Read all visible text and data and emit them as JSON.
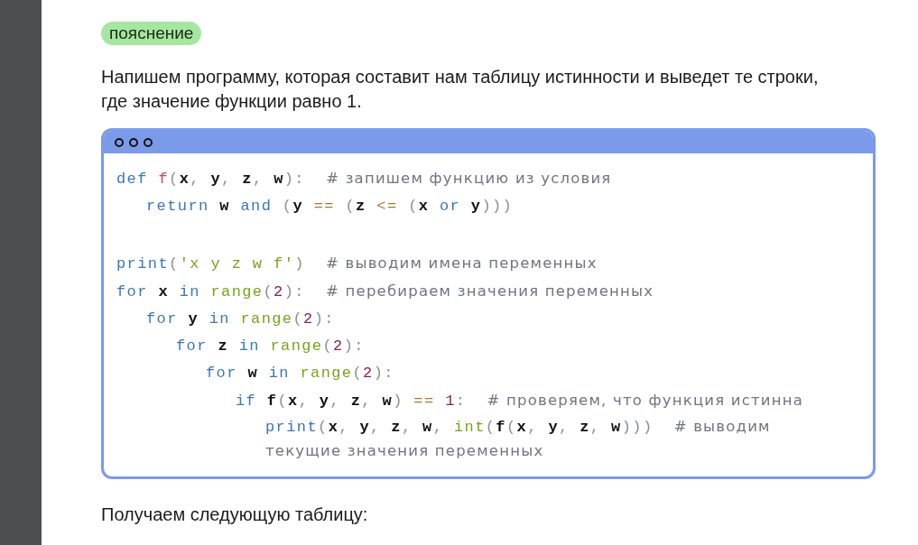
{
  "badge": "пояснение",
  "intro": "Напишем программу, которая составит нам таблицу истинности и выведет те строки, где значение функции равно 1.",
  "code_window": {
    "lines": [
      {
        "tokens": [
          {
            "kind": "kw",
            "text": "def "
          },
          {
            "kind": "def",
            "text": "f"
          },
          {
            "kind": "punct",
            "text": "("
          },
          {
            "kind": "name",
            "text": "x"
          },
          {
            "kind": "punct",
            "text": ", "
          },
          {
            "kind": "name",
            "text": "y"
          },
          {
            "kind": "punct",
            "text": ", "
          },
          {
            "kind": "name",
            "text": "z"
          },
          {
            "kind": "punct",
            "text": ", "
          },
          {
            "kind": "name",
            "text": "w"
          },
          {
            "kind": "punct",
            "text": "):  "
          },
          {
            "kind": "comment",
            "text": "# запишем функцию из условия"
          }
        ],
        "children": [
          {
            "tokens": [
              {
                "kind": "kw",
                "text": "return "
              },
              {
                "kind": "name",
                "text": "w "
              },
              {
                "kind": "kw",
                "text": "and "
              },
              {
                "kind": "punct",
                "text": "("
              },
              {
                "kind": "name",
                "text": "y "
              },
              {
                "kind": "op",
                "text": "== "
              },
              {
                "kind": "punct",
                "text": "("
              },
              {
                "kind": "name",
                "text": "z "
              },
              {
                "kind": "op",
                "text": "<= "
              },
              {
                "kind": "punct",
                "text": "("
              },
              {
                "kind": "name",
                "text": "x "
              },
              {
                "kind": "kw",
                "text": "or "
              },
              {
                "kind": "name",
                "text": "y"
              },
              {
                "kind": "punct",
                "text": ")))"
              }
            ]
          }
        ]
      },
      {
        "blank": true
      },
      {
        "tokens": [
          {
            "kind": "kw",
            "text": "print"
          },
          {
            "kind": "punct",
            "text": "("
          },
          {
            "kind": "str",
            "text": "'x y z w f'"
          },
          {
            "kind": "punct",
            "text": ")  "
          },
          {
            "kind": "comment",
            "text": "# выводим имена переменных"
          }
        ]
      },
      {
        "tokens": [
          {
            "kind": "kw",
            "text": "for "
          },
          {
            "kind": "name",
            "text": "x "
          },
          {
            "kind": "kw",
            "text": "in "
          },
          {
            "kind": "builtin",
            "text": "range"
          },
          {
            "kind": "punct",
            "text": "("
          },
          {
            "kind": "num",
            "text": "2"
          },
          {
            "kind": "punct",
            "text": "):  "
          },
          {
            "kind": "comment",
            "text": "# перебираем значения переменных"
          }
        ],
        "children": [
          {
            "tokens": [
              {
                "kind": "kw",
                "text": "for "
              },
              {
                "kind": "name",
                "text": "y "
              },
              {
                "kind": "kw",
                "text": "in "
              },
              {
                "kind": "builtin",
                "text": "range"
              },
              {
                "kind": "punct",
                "text": "("
              },
              {
                "kind": "num",
                "text": "2"
              },
              {
                "kind": "punct",
                "text": "):"
              }
            ],
            "children": [
              {
                "tokens": [
                  {
                    "kind": "kw",
                    "text": "for "
                  },
                  {
                    "kind": "name",
                    "text": "z "
                  },
                  {
                    "kind": "kw",
                    "text": "in "
                  },
                  {
                    "kind": "builtin",
                    "text": "range"
                  },
                  {
                    "kind": "punct",
                    "text": "("
                  },
                  {
                    "kind": "num",
                    "text": "2"
                  },
                  {
                    "kind": "punct",
                    "text": "):"
                  }
                ],
                "children": [
                  {
                    "tokens": [
                      {
                        "kind": "kw",
                        "text": "for "
                      },
                      {
                        "kind": "name",
                        "text": "w "
                      },
                      {
                        "kind": "kw",
                        "text": "in "
                      },
                      {
                        "kind": "builtin",
                        "text": "range"
                      },
                      {
                        "kind": "punct",
                        "text": "("
                      },
                      {
                        "kind": "num",
                        "text": "2"
                      },
                      {
                        "kind": "punct",
                        "text": "):"
                      }
                    ],
                    "children": [
                      {
                        "tokens": [
                          {
                            "kind": "kw",
                            "text": "if "
                          },
                          {
                            "kind": "name",
                            "text": "f"
                          },
                          {
                            "kind": "punct",
                            "text": "("
                          },
                          {
                            "kind": "name",
                            "text": "x"
                          },
                          {
                            "kind": "punct",
                            "text": ", "
                          },
                          {
                            "kind": "name",
                            "text": "y"
                          },
                          {
                            "kind": "punct",
                            "text": ", "
                          },
                          {
                            "kind": "name",
                            "text": "z"
                          },
                          {
                            "kind": "punct",
                            "text": ", "
                          },
                          {
                            "kind": "name",
                            "text": "w"
                          },
                          {
                            "kind": "punct",
                            "text": ") "
                          },
                          {
                            "kind": "op",
                            "text": "== "
                          },
                          {
                            "kind": "num",
                            "text": "1"
                          },
                          {
                            "kind": "punct",
                            "text": ":  "
                          },
                          {
                            "kind": "comment",
                            "text": "# проверяем, что функция истинна"
                          }
                        ],
                        "children": [
                          {
                            "tokens": [
                              {
                                "kind": "kw",
                                "text": "print"
                              },
                              {
                                "kind": "punct",
                                "text": "("
                              },
                              {
                                "kind": "name",
                                "text": "x"
                              },
                              {
                                "kind": "punct",
                                "text": ", "
                              },
                              {
                                "kind": "name",
                                "text": "y"
                              },
                              {
                                "kind": "punct",
                                "text": ", "
                              },
                              {
                                "kind": "name",
                                "text": "z"
                              },
                              {
                                "kind": "punct",
                                "text": ", "
                              },
                              {
                                "kind": "name",
                                "text": "w"
                              },
                              {
                                "kind": "punct",
                                "text": ", "
                              },
                              {
                                "kind": "builtin",
                                "text": "int"
                              },
                              {
                                "kind": "punct",
                                "text": "("
                              },
                              {
                                "kind": "name",
                                "text": "f"
                              },
                              {
                                "kind": "punct",
                                "text": "("
                              },
                              {
                                "kind": "name",
                                "text": "x"
                              },
                              {
                                "kind": "punct",
                                "text": ", "
                              },
                              {
                                "kind": "name",
                                "text": "y"
                              },
                              {
                                "kind": "punct",
                                "text": ", "
                              },
                              {
                                "kind": "name",
                                "text": "z"
                              },
                              {
                                "kind": "punct",
                                "text": ", "
                              },
                              {
                                "kind": "name",
                                "text": "w"
                              },
                              {
                                "kind": "punct",
                                "text": ")))  "
                              },
                              {
                                "kind": "comment",
                                "text": "# выводим текущие значения переменных"
                              }
                            ]
                          }
                        ]
                      }
                    ]
                  }
                ]
              }
            ]
          }
        ]
      }
    ]
  },
  "outro": "Получаем следующую таблицу:"
}
